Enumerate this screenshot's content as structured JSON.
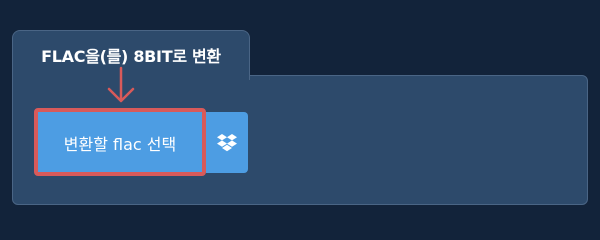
{
  "tab": {
    "title": "FLAC을(를) 8BIT로 변환"
  },
  "upload": {
    "select_label": "변환할 flac 선택",
    "dropbox_icon": "dropbox-icon"
  },
  "colors": {
    "background": "#12233a",
    "panel": "#2d4a6b",
    "button": "#4d9de3",
    "highlight": "#d85a5a"
  }
}
